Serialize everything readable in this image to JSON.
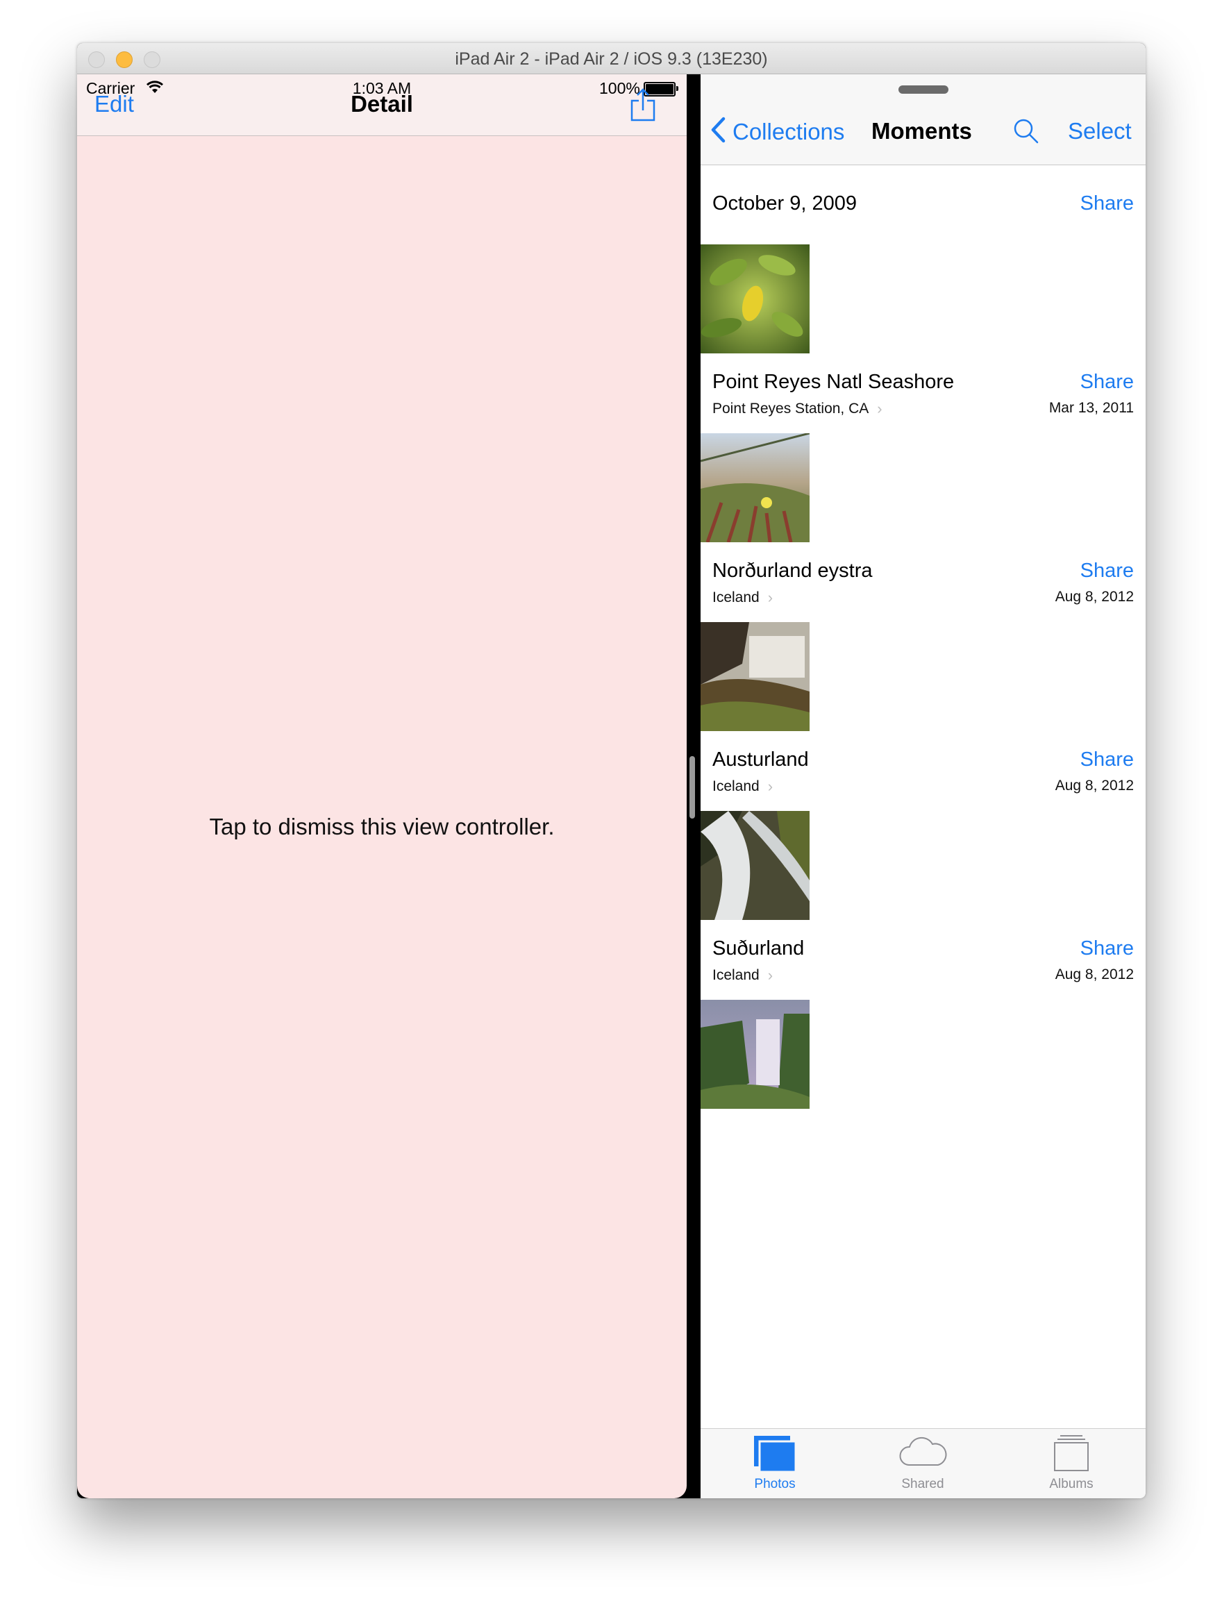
{
  "window": {
    "title": "iPad Air 2 - iPad Air 2 / iOS 9.3 (13E230)"
  },
  "status_bar": {
    "carrier": "Carrier",
    "time": "1:03 AM",
    "battery": "100%"
  },
  "detail": {
    "edit_label": "Edit",
    "title": "Detail",
    "share_icon": "share-icon",
    "message": "Tap to dismiss this view controller.",
    "background": "#fce4e4"
  },
  "photos": {
    "back_label": "Collections",
    "title": "Moments",
    "select_label": "Select",
    "accent": "#1e7cf0",
    "moments": [
      {
        "title": "October 9, 2009",
        "subtitle": "",
        "date": "",
        "share": "Share"
      },
      {
        "title": "Point Reyes Natl Seashore",
        "subtitle": "Point Reyes Station, CA",
        "date": "Mar 13, 2011",
        "share": "Share"
      },
      {
        "title": "Norðurland eystra",
        "subtitle": "Iceland",
        "date": "Aug 8, 2012",
        "share": "Share"
      },
      {
        "title": "Austurland",
        "subtitle": "Iceland",
        "date": "Aug 8, 2012",
        "share": "Share"
      },
      {
        "title": "Suðurland",
        "subtitle": "Iceland",
        "date": "Aug 8, 2012",
        "share": "Share"
      }
    ],
    "tabs": [
      {
        "label": "Photos",
        "icon": "photos-icon",
        "selected": true
      },
      {
        "label": "Shared",
        "icon": "cloud-icon",
        "selected": false
      },
      {
        "label": "Albums",
        "icon": "albums-icon",
        "selected": false
      }
    ]
  }
}
